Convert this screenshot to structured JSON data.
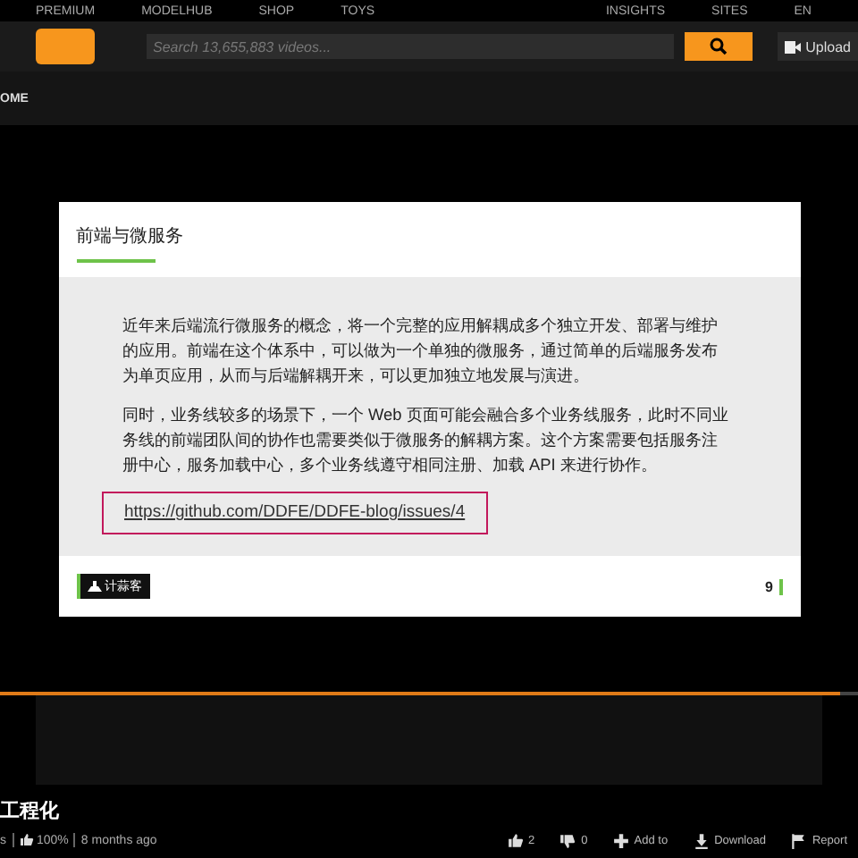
{
  "top_nav": [
    "PREMIUM",
    "MODELHUB",
    "SHOP",
    "TOYS",
    "INSIGHTS",
    "SITES",
    "EN"
  ],
  "search": {
    "placeholder": "Search 13,655,883 videos..."
  },
  "upload": "Upload",
  "category_nav": [
    "OME"
  ],
  "slide": {
    "title": "前端与微服务",
    "paragraphs": [
      "近年来后端流行微服务的概念，将一个完整的应用解耦成多个独立开发、部署与维护的应用。前端在这个体系中，可以做为一个单独的微服务，通过简单的后端服务发布为单页应用，从而与后端解耦开来，可以更加独立地发展与演进。",
      "同时，业务线较多的场景下，一个 Web 页面可能会融合多个业务线服务，此时不同业务线的前端团队间的协作也需要类似于微服务的解耦方案。这个方案需要包括服务注册中心，服务加载中心，多个业务线遵守相同注册、加载 API 来进行协作。"
    ],
    "link": "https://github.com/DDFE/DDFE-blog/issues/4",
    "brand": "计蒜客",
    "page": "9"
  },
  "player": {
    "level": 0.98
  },
  "video_title": "工程化",
  "meta": {
    "views": "s",
    "rating": "100%",
    "age": "8 months ago"
  },
  "actions": [
    {
      "kind": "like",
      "label": "2"
    },
    {
      "kind": "dislike",
      "label": "0"
    },
    {
      "kind": "add",
      "label": "Add to"
    },
    {
      "kind": "download",
      "label": "Download"
    },
    {
      "kind": "report",
      "label": "Report"
    }
  ]
}
